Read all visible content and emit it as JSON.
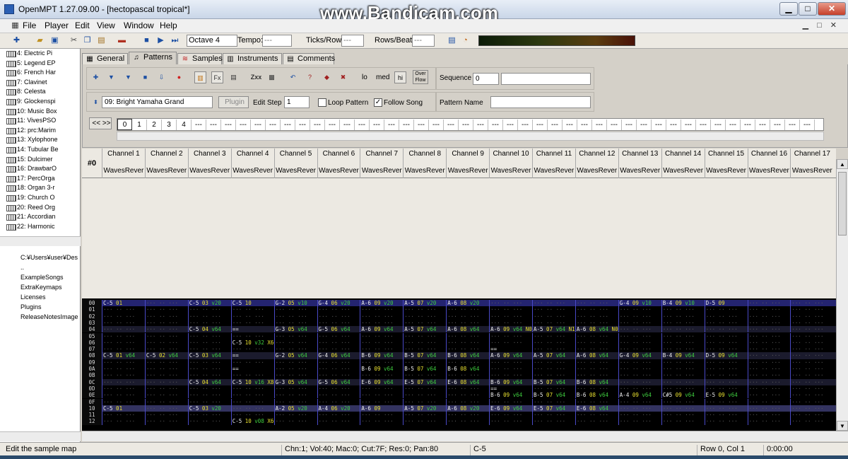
{
  "window": {
    "title": "OpenMPT 1.27.09.00 - [hectopascal tropical*]",
    "watermark": "www.Bandicam.com",
    "min": "▁",
    "max": "□",
    "close": "✕"
  },
  "menu": [
    "File",
    "Player",
    "Edit",
    "View",
    "Window",
    "Help"
  ],
  "toolbar": {
    "octave": "Octave 4",
    "tempo_label": "Tempo:",
    "tempo_value": "---",
    "ticks_label": "Ticks/Row:",
    "ticks_value": "---",
    "rows_label": "Rows/Beat:",
    "rows_value": "---"
  },
  "instruments": [
    "4: Electric Pi",
    "5: Legend EP",
    "6: French Har",
    "7: Clavinet",
    "8: Celesta",
    "9: Glockenspi",
    "10: Music Box",
    "11: VivesPSO",
    "12: prc:Marim",
    "13: Xylophone",
    "14: Tubular Be",
    "15: Dulcimer",
    "16: DrawbarO",
    "17: PercOrga",
    "18: Organ 3-r",
    "19: Church O",
    "20: Reed Org",
    "21: Accordian",
    "22: Harmonic"
  ],
  "files": [
    "C:¥Users¥user¥Des",
    "..",
    "ExampleSongs",
    "ExtraKeymaps",
    "Licenses",
    "Plugins",
    "ReleaseNotesImage"
  ],
  "tabs": [
    "General",
    "Patterns",
    "Samples",
    "Instruments",
    "Comments"
  ],
  "pattern_ctl": {
    "sequence_label": "Sequence",
    "sequence_value": "0",
    "instrument": "09: Bright Yamaha Grand",
    "plugin": "Plugin",
    "edit_step_label": "Edit Step",
    "edit_step_value": "1",
    "loop": "Loop Pattern",
    "follow": "Follow Song",
    "name_label": "Pattern Name",
    "lo": "lo",
    "med": "med",
    "hi": "hi",
    "overflow": "Over Flow",
    "zxx": "Zxx",
    "nav": "<< >>"
  },
  "orders": [
    "0",
    "1",
    "2",
    "3",
    "4"
  ],
  "order_fill": "---",
  "pattern_no": "#0",
  "channels": [
    "Channel 1",
    "Channel 2",
    "Channel 3",
    "Channel 4",
    "Channel 5",
    "Channel 6",
    "Channel 7",
    "Channel 8",
    "Channel 9",
    "Channel 10",
    "Channel 11",
    "Channel 12",
    "Channel 13",
    "Channel 14",
    "Channel 15",
    "Channel 16",
    "Channel 17"
  ],
  "channel_plugin": "WavesRever",
  "rows": [
    {
      "n": "00",
      "c": [
        "C-5 01",
        "",
        "C-5 03 v20",
        "C-5 10",
        "G-2 05 v10",
        "G-4 06 v20",
        "A-6 09 v20",
        "A-5 07 v20",
        "A-6 08 v20",
        "",
        "",
        "",
        "G-4 09 v10",
        "B-4 09 v10",
        "D-5 09",
        "",
        ""
      ]
    },
    {
      "n": "01",
      "c": [
        "",
        "",
        "",
        "",
        "",
        "",
        "",
        "",
        "",
        "",
        "",
        "",
        "",
        "",
        "",
        "",
        ""
      ]
    },
    {
      "n": "02",
      "c": [
        "",
        "",
        "",
        "",
        "",
        "",
        "",
        "",
        "",
        "",
        "",
        "",
        "",
        "",
        "",
        "",
        ""
      ]
    },
    {
      "n": "03",
      "c": [
        "",
        "",
        "",
        "",
        "",
        "",
        "",
        "",
        "",
        "",
        "",
        "",
        "",
        "",
        "",
        "",
        ""
      ]
    },
    {
      "n": "04",
      "c": [
        "",
        "",
        "C-5 04 v64",
        "==",
        "G-3 05 v64",
        "G-5 06 v64",
        "A-6 09 v64",
        "A-5 07 v64",
        "A-6 08 v64",
        "A-6 09 v64 N0C",
        "A-5 07 v64 N18",
        "A-6 08 v64 N0C",
        "",
        "",
        "",
        "",
        ""
      ]
    },
    {
      "n": "05",
      "c": [
        "",
        "",
        "",
        "",
        "",
        "",
        "",
        "",
        "",
        "",
        "",
        "",
        "",
        "",
        "",
        "",
        ""
      ]
    },
    {
      "n": "06",
      "c": [
        "",
        "",
        "",
        "C-5 10 v32 X60",
        "",
        "",
        "",
        "",
        "",
        "",
        "",
        "",
        "",
        "",
        "",
        "",
        ""
      ]
    },
    {
      "n": "07",
      "c": [
        "",
        "",
        "",
        "",
        "",
        "",
        "",
        "",
        "",
        "==",
        "",
        "",
        "",
        "",
        "",
        "",
        ""
      ]
    },
    {
      "n": "08",
      "c": [
        "C-5 01 v64",
        "C-5 02 v64",
        "C-5 03 v64",
        "==",
        "G-2 05 v64",
        "G-4 06 v64",
        "B-6 09 v64",
        "B-5 07 v64",
        "B-6 08 v64",
        "A-6 09 v64",
        "A-5 07 v64",
        "A-6 08 v64",
        "G-4 09 v64",
        "B-4 09 v64",
        "D-5 09 v64",
        "",
        ""
      ]
    },
    {
      "n": "09",
      "c": [
        "",
        "",
        "",
        "",
        "",
        "",
        "",
        "",
        "",
        "",
        "",
        "",
        "",
        "",
        "",
        "",
        ""
      ]
    },
    {
      "n": "0A",
      "c": [
        "",
        "",
        "",
        "==",
        "",
        "",
        "B-6 09 v64",
        "B-5 07 v64",
        "B-6 08 v64",
        "",
        "",
        "",
        "",
        "",
        "",
        "",
        ""
      ]
    },
    {
      "n": "0B",
      "c": [
        "",
        "",
        "",
        "",
        "",
        "",
        "",
        "",
        "",
        "",
        "",
        "",
        "",
        "",
        "",
        "",
        ""
      ]
    },
    {
      "n": "0C",
      "c": [
        "",
        "",
        "C-5 04 v64",
        "C-5 10 v16 X80",
        "G-3 05 v64",
        "G-5 06 v64",
        "E-6 09 v64",
        "E-5 07 v64",
        "E-6 08 v64",
        "B-6 09 v64",
        "B-5 07 v64",
        "B-6 08 v64",
        "",
        "",
        "",
        "",
        ""
      ]
    },
    {
      "n": "0D",
      "c": [
        "",
        "",
        "",
        "",
        "",
        "",
        "",
        "",
        "",
        "==",
        "",
        "",
        "",
        "",
        "",
        "",
        ""
      ]
    },
    {
      "n": "0E",
      "c": [
        "",
        "",
        "",
        "",
        "",
        "",
        "",
        "",
        "",
        "B-6 09 v64",
        "B-5 07 v64",
        "B-6 08 v64",
        "A-4 09 v64",
        "C#5 09 v64",
        "E-5 09 v64",
        "",
        ""
      ]
    },
    {
      "n": "0F",
      "c": [
        "",
        "",
        "",
        "",
        "",
        "",
        "",
        "",
        "",
        "",
        "",
        "",
        "",
        "",
        "",
        "",
        ""
      ]
    },
    {
      "n": "10",
      "c": [
        "C-5 01",
        "",
        "C-5 03 v20",
        "",
        "A-2 05 v20",
        "A-4 06 v20",
        "A-6 09",
        "A-5 07 v20",
        "A-6 08 v20",
        "E-6 09 v64",
        "E-5 07 v64",
        "E-6 08 v64",
        "",
        "",
        "",
        "",
        ""
      ]
    },
    {
      "n": "11",
      "c": [
        "",
        "",
        "",
        "",
        "",
        "",
        "",
        "",
        "",
        "",
        "",
        "",
        "",
        "",
        "",
        "",
        ""
      ]
    },
    {
      "n": "12",
      "c": [
        "",
        "",
        "",
        "C-5 10 v08 X60",
        "",
        "",
        "",
        "",
        "",
        "",
        "",
        "",
        "",
        "",
        "",
        "",
        ""
      ]
    }
  ],
  "status": {
    "hint": "Edit the sample map",
    "info": "Chn:1; Vol:40; Mac:0; Cut:7F; Res:0; Pan:80",
    "note": "C-5",
    "pos": "Row 0, Col 1",
    "time": "0:00:00"
  }
}
